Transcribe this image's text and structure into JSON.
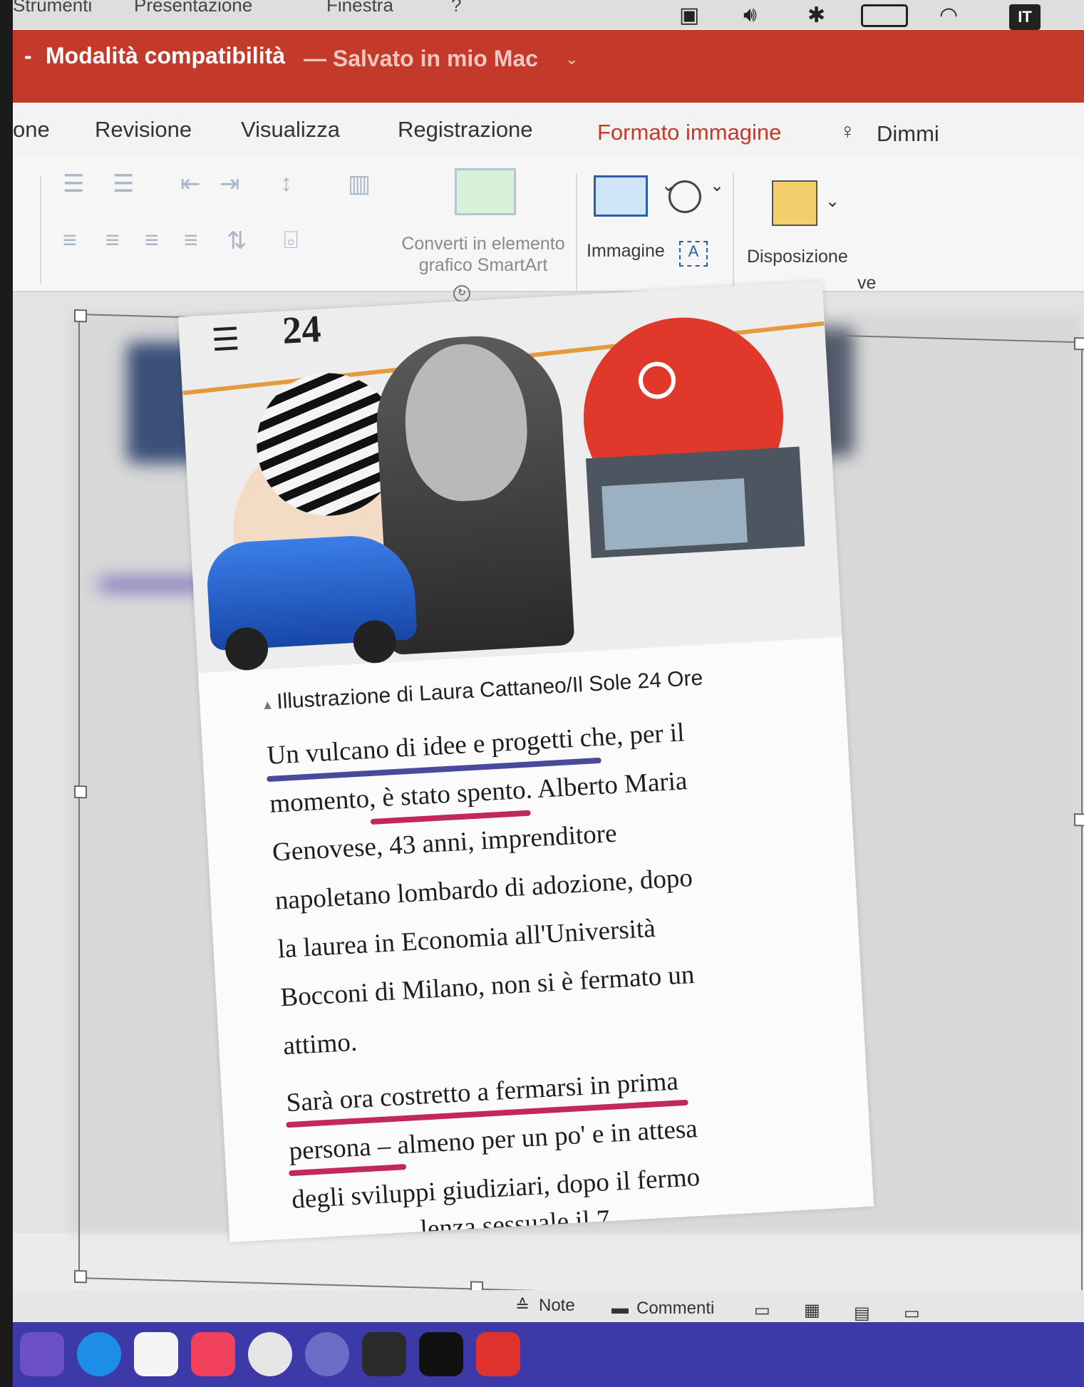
{
  "menubar": {
    "items": [
      "Strumenti",
      "Presentazione",
      "Finestra",
      "?"
    ],
    "language_badge": "IT"
  },
  "titlebar": {
    "prefix": "-",
    "mode": "Modalità compatibilità",
    "saved": "— Salvato in mio Mac"
  },
  "ribbon_tabs": [
    {
      "label": "one"
    },
    {
      "label": "Revisione"
    },
    {
      "label": "Visualizza"
    },
    {
      "label": "Registrazione"
    },
    {
      "label": "Formato immagine"
    },
    {
      "label": "Dimmi"
    }
  ],
  "ribbon": {
    "smartart_line1": "Converti in elemento",
    "smartart_line2": "grafico SmartArt",
    "image_label": "Immagine",
    "arrange_label": "Disposizione",
    "truncated_label": "ve"
  },
  "article": {
    "masthead": "24",
    "caption": "Illustrazione di Laura Cattaneo/Il Sole 24 Ore",
    "paragraph1": [
      "Un vulcano di idee e progetti che, per il",
      "momento, è stato spento. Alberto Maria",
      "Genovese, 43 anni, imprenditore",
      "napoletano lombardo di adozione, dopo",
      "la laurea in Economia all'Università",
      "Bocconi di Milano, non si è fermato un",
      "attimo."
    ],
    "paragraph2": [
      "Sarà ora costretto a fermarsi in prima",
      "persona – almeno per un po' e in attesa",
      "degli sviluppi giudiziari, dopo il fermo",
      "...lenza sessuale il 7"
    ],
    "underline_blue": "#4a4a9c",
    "underline_red": "#c2285a"
  },
  "statusbar": {
    "notes": "Note",
    "comments": "Commenti"
  },
  "colors": {
    "titlebar": "#c33a2b",
    "active_tab": "#c3392b",
    "dock": "#3b3aa8"
  }
}
